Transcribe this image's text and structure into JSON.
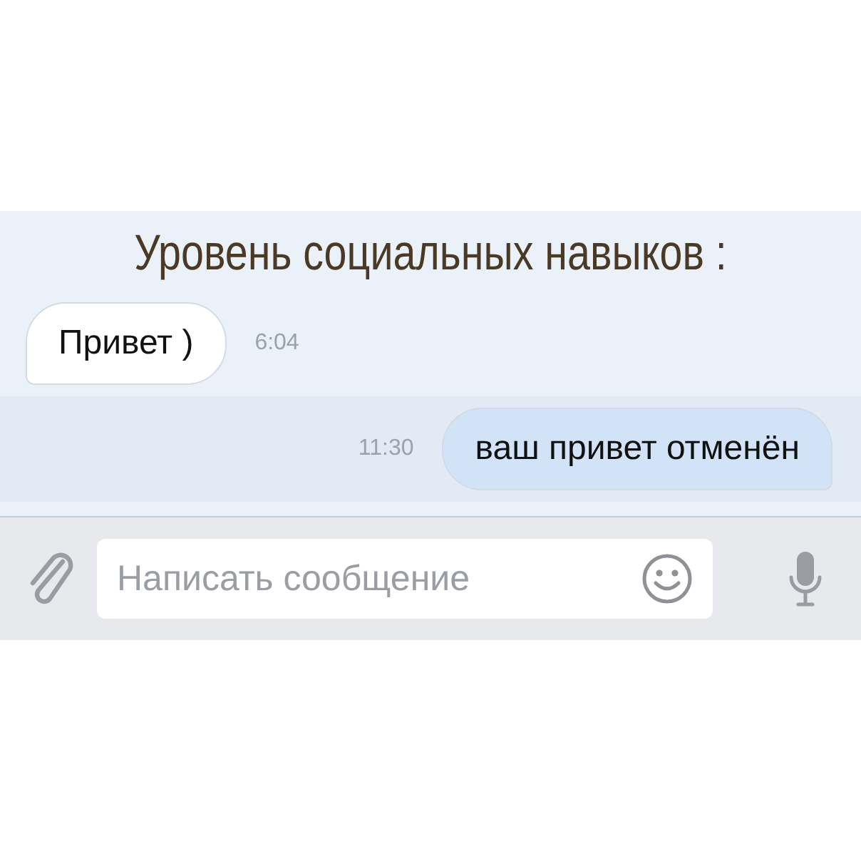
{
  "caption": "Уровень социальных навыков :",
  "messages": [
    {
      "kind": "incoming",
      "text": "Привет )",
      "time": "6:04"
    },
    {
      "kind": "outgoing",
      "text": "ваш привет отменён",
      "time": "11:30"
    }
  ],
  "composer": {
    "placeholder": "Написать сообщение"
  }
}
